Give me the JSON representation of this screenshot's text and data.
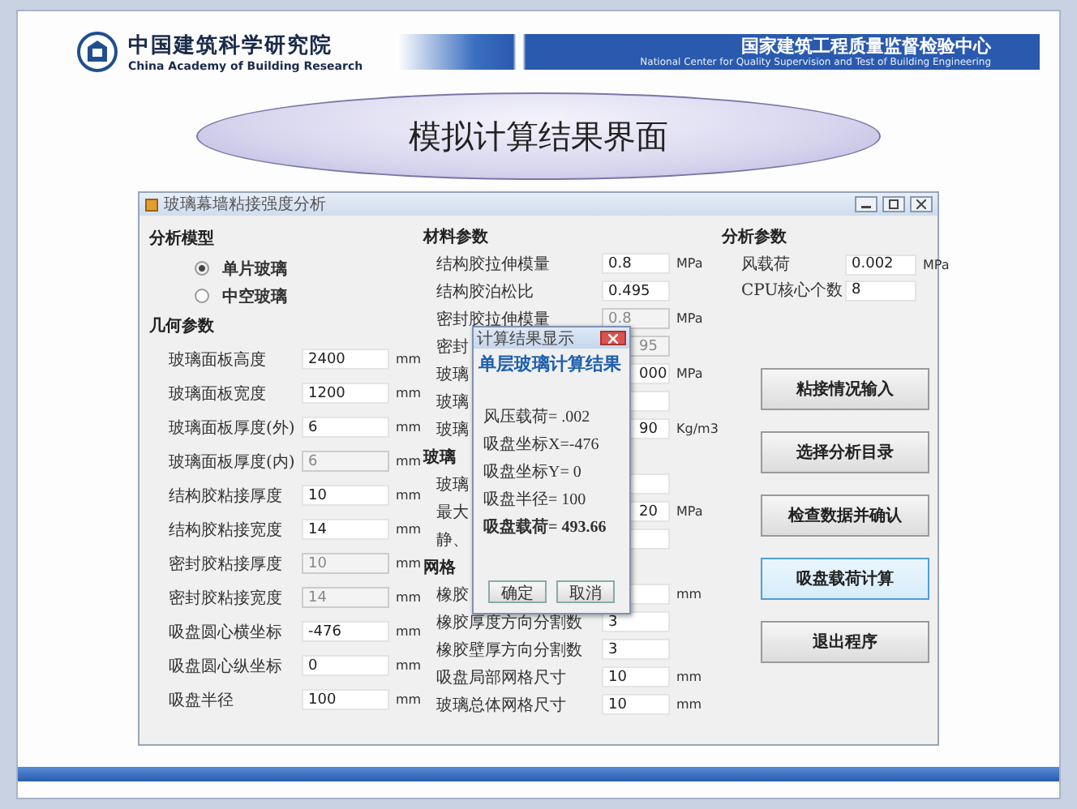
{
  "slide": {
    "org_cn": "中国建筑科学研究院",
    "org_en": "China Academy of Building Research",
    "center_cn": "国家建筑工程质量监督检验中心",
    "center_en": "National Center for Quality Supervision and Test of Building Engineering",
    "title": "模拟计算结果界面"
  },
  "window": {
    "title": "玻璃幕墙粘接强度分析",
    "columns": [
      {
        "items": [
          {
            "kind": "heading",
            "text": "分析模型"
          },
          {
            "kind": "radio",
            "label": "单片玻璃",
            "selected": true
          },
          {
            "kind": "radio",
            "label": "中空玻璃",
            "selected": false
          },
          {
            "kind": "heading",
            "text": "几何参数"
          },
          {
            "kind": "field",
            "label": "玻璃面板高度",
            "value": "2400",
            "unit": "mm",
            "disabled": false
          },
          {
            "kind": "field",
            "label": "玻璃面板宽度",
            "value": "1200",
            "unit": "mm",
            "disabled": false
          },
          {
            "kind": "field",
            "label": "玻璃面板厚度(外)",
            "value": "6",
            "unit": "mm",
            "disabled": false
          },
          {
            "kind": "field",
            "label": "玻璃面板厚度(内)",
            "value": "6",
            "unit": "mm",
            "disabled": true
          },
          {
            "kind": "field",
            "label": "结构胶粘接厚度",
            "value": "10",
            "unit": "mm",
            "disabled": false
          },
          {
            "kind": "field",
            "label": "结构胶粘接宽度",
            "value": "14",
            "unit": "mm",
            "disabled": false
          },
          {
            "kind": "field",
            "label": "密封胶粘接厚度",
            "value": "10",
            "unit": "mm",
            "disabled": true
          },
          {
            "kind": "field",
            "label": "密封胶粘接宽度",
            "value": "14",
            "unit": "mm",
            "disabled": true
          },
          {
            "kind": "field",
            "label": "吸盘圆心横坐标",
            "value": "-476",
            "unit": "mm",
            "disabled": false
          },
          {
            "kind": "field",
            "label": "吸盘圆心纵坐标",
            "value": "0",
            "unit": "mm",
            "disabled": false
          },
          {
            "kind": "field",
            "label": "吸盘半径",
            "value": "100",
            "unit": "mm",
            "disabled": false
          }
        ]
      },
      {
        "items": [
          {
            "kind": "heading",
            "text": "材料参数"
          },
          {
            "kind": "field",
            "label": "结构胶拉伸模量",
            "value": "0.8",
            "unit": "MPa",
            "disabled": false
          },
          {
            "kind": "field",
            "label": "结构胶泊松比",
            "value": "0.495",
            "disabled": false
          },
          {
            "kind": "field",
            "label": "密封胶拉伸模量",
            "value": "0.8",
            "unit": "MPa",
            "disabled": true
          },
          {
            "kind": "covered-field",
            "label": "密封",
            "value": "95",
            "disabled": true
          },
          {
            "kind": "covered-field",
            "label": "玻璃",
            "value": "000",
            "unit": "MPa",
            "disabled": false
          },
          {
            "kind": "covered-field",
            "label": "玻璃",
            "disabled": false
          },
          {
            "kind": "covered-field",
            "label": "玻璃",
            "value": "90",
            "unit": "Kg/m3",
            "disabled": false
          },
          {
            "kind": "heading",
            "text": "玻璃"
          },
          {
            "kind": "covered-field",
            "label": "玻璃",
            "disabled": false
          },
          {
            "kind": "covered-field",
            "label": "最大",
            "value": "20",
            "unit": "MPa",
            "disabled": false
          },
          {
            "kind": "covered-field",
            "label": "静、",
            "disabled": false
          },
          {
            "kind": "heading",
            "text": "网格"
          },
          {
            "kind": "covered-field",
            "label": "橡胶",
            "unit": "mm",
            "disabled": false
          },
          {
            "kind": "field",
            "label": "橡胶厚度方向分割数",
            "value": "3",
            "disabled": false
          },
          {
            "kind": "field",
            "label": "橡胶壁厚方向分割数",
            "value": "3",
            "disabled": false
          },
          {
            "kind": "field",
            "label": "吸盘局部网格尺寸",
            "value": "10",
            "unit": "mm",
            "disabled": false
          },
          {
            "kind": "field",
            "label": "玻璃总体网格尺寸",
            "value": "10",
            "unit": "mm",
            "disabled": false
          }
        ]
      },
      {
        "items": [
          {
            "kind": "heading",
            "text": "分析参数"
          },
          {
            "kind": "field",
            "label": "风载荷",
            "value": "0.002",
            "unit": "MPa",
            "disabled": false
          },
          {
            "kind": "field",
            "label": "CPU核心个数",
            "value": "8",
            "disabled": false
          },
          {
            "kind": "button",
            "label": "粘接情况输入",
            "focused": false
          },
          {
            "kind": "button",
            "label": "选择分析目录",
            "focused": false
          },
          {
            "kind": "button",
            "label": "检查数据并确认",
            "focused": false
          },
          {
            "kind": "button",
            "label": "吸盘载荷计算",
            "focused": true
          },
          {
            "kind": "button",
            "label": "退出程序",
            "focused": false
          }
        ]
      }
    ]
  },
  "dialog": {
    "title": "计算结果显示",
    "heading": "单层玻璃计算结果",
    "lines": [
      {
        "text": "风压载荷= .002",
        "bold": false
      },
      {
        "text": "吸盘坐标X=-476",
        "bold": false
      },
      {
        "text": "吸盘坐标Y= 0",
        "bold": false
      },
      {
        "text": "吸盘半径= 100",
        "bold": false
      },
      {
        "text": "吸盘载荷= 493.66",
        "bold": true
      }
    ],
    "buttons": [
      "确定",
      "取消"
    ]
  }
}
